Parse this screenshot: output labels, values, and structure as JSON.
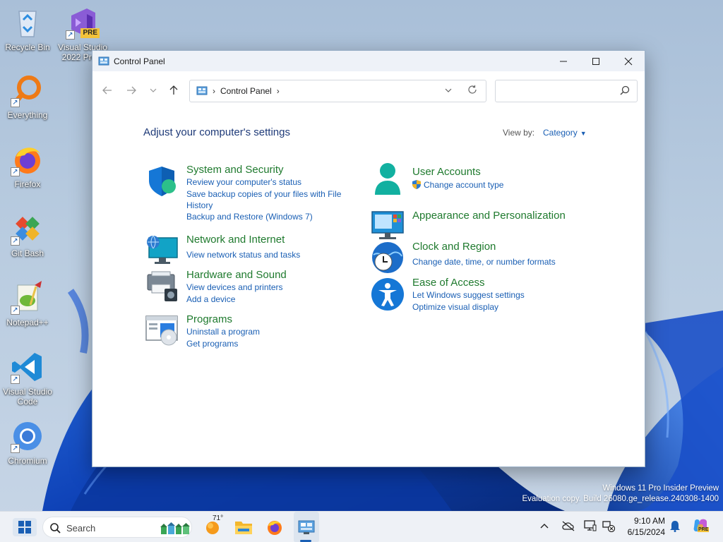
{
  "desktop": {
    "icons": [
      {
        "label": "Recycle Bin"
      },
      {
        "label": "Visual Studio 2022 Pre..."
      },
      {
        "label": "Everything"
      },
      {
        "label": "Firefox"
      },
      {
        "label": "Git Bash"
      },
      {
        "label": "Notepad++"
      },
      {
        "label": "Visual Studio Code"
      },
      {
        "label": "Chromium"
      }
    ],
    "vs_badge": "PRE"
  },
  "window": {
    "title": "Control Panel",
    "address": {
      "crumb": "Control Panel"
    },
    "search": {
      "placeholder": ""
    },
    "heading": "Adjust your computer's settings",
    "view_by_label": "View by:",
    "view_by_value": "Category",
    "categories": [
      {
        "title": "System and Security",
        "links": [
          "Review your computer's status",
          "Save backup copies of your files with File History",
          "Backup and Restore (Windows 7)"
        ]
      },
      {
        "title": "Network and Internet",
        "links": [
          "View network status and tasks"
        ]
      },
      {
        "title": "Hardware and Sound",
        "links": [
          "View devices and printers",
          "Add a device"
        ]
      },
      {
        "title": "Programs",
        "links": [
          "Uninstall a program",
          "Get programs"
        ]
      },
      {
        "title": "User Accounts",
        "links": [
          "Change account type"
        ]
      },
      {
        "title": "Appearance and Personalization",
        "links": []
      },
      {
        "title": "Clock and Region",
        "links": [
          "Change date, time, or number formats"
        ]
      },
      {
        "title": "Ease of Access",
        "links": [
          "Let Windows suggest settings",
          "Optimize visual display"
        ]
      }
    ]
  },
  "watermark": {
    "line1": "Windows 11 Pro Insider Preview",
    "line2": "Evaluation copy. Build 26080.ge_release.240308-1400"
  },
  "taskbar": {
    "search_label": "Search",
    "weather_temp": "71°",
    "time": "9:10 AM",
    "date": "6/15/2024",
    "copilot_badge": "PRE"
  },
  "colors": {
    "accent": "#1a5fb4",
    "category_title": "#1f7a2e",
    "heading": "#1e3a78"
  }
}
